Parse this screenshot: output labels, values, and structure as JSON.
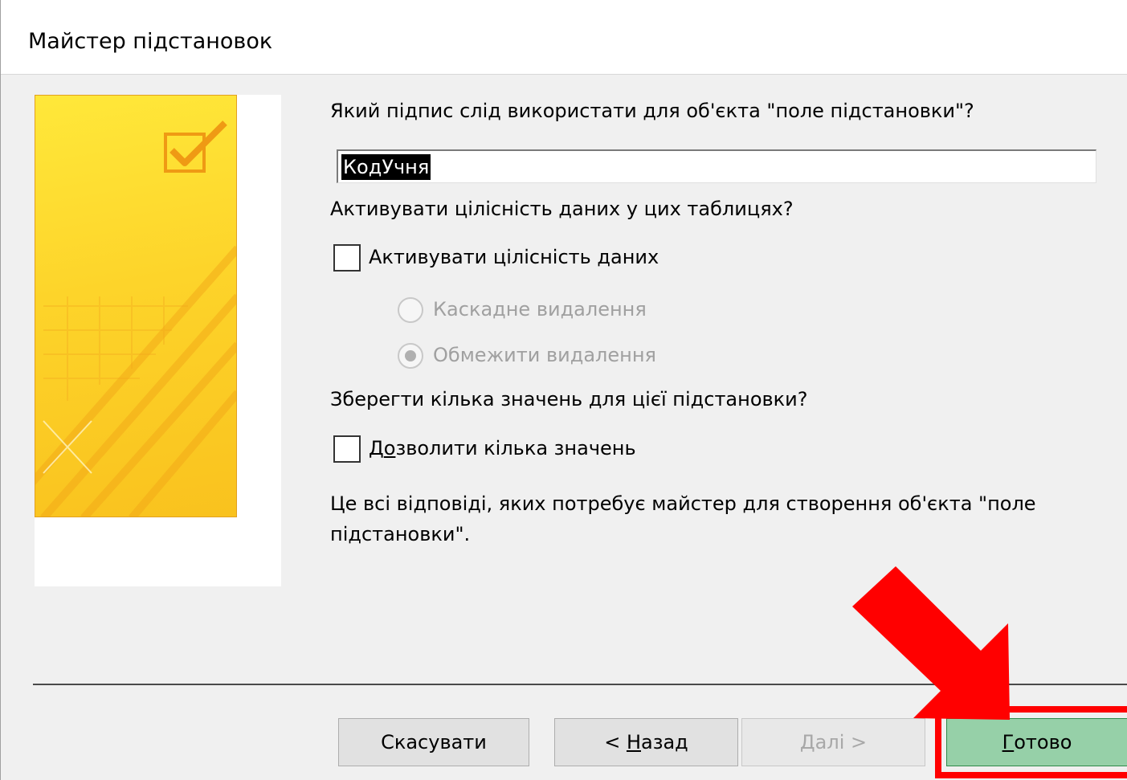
{
  "window": {
    "title": "Майстер підстановок"
  },
  "caption": {
    "question": "Який підпис слід використати для об'єкта \"поле підстановки\"?",
    "value": "КодУчня"
  },
  "integrity": {
    "question": "Активувати цілісність даних у цих таблицях?",
    "checkbox_label_pre": "Активувати цілісність ",
    "checkbox_label_accel": "д",
    "checkbox_label_post": "аних",
    "checked": false,
    "cascade_label": "Каскадне видалення",
    "restrict_label": "Обмежити видалення",
    "selected_option": "restrict"
  },
  "multivalue": {
    "question": "Зберегти кілька значень для цієї підстановки?",
    "checkbox_label_pre": "Д",
    "checkbox_label_accel": "о",
    "checkbox_label_post": "зволити кілька значень",
    "checked": false
  },
  "summary": {
    "line1": "Це всі відповіді, яких потребує майстер для створення об'єкта \"поле",
    "line2": "підстановки\"."
  },
  "buttons": {
    "cancel": "Скасувати",
    "back_prefix": "< ",
    "back_accel": "Н",
    "back_rest": "азад",
    "next_accel": "Д",
    "next_rest": "алі >",
    "finish_accel": "Г",
    "finish_rest": "отово"
  },
  "colors": {
    "highlight": "#ff0000",
    "finish_button": "#96d0a8"
  },
  "annotation": {
    "arrow_icon": "red-arrow-icon",
    "target": "finish-button"
  }
}
